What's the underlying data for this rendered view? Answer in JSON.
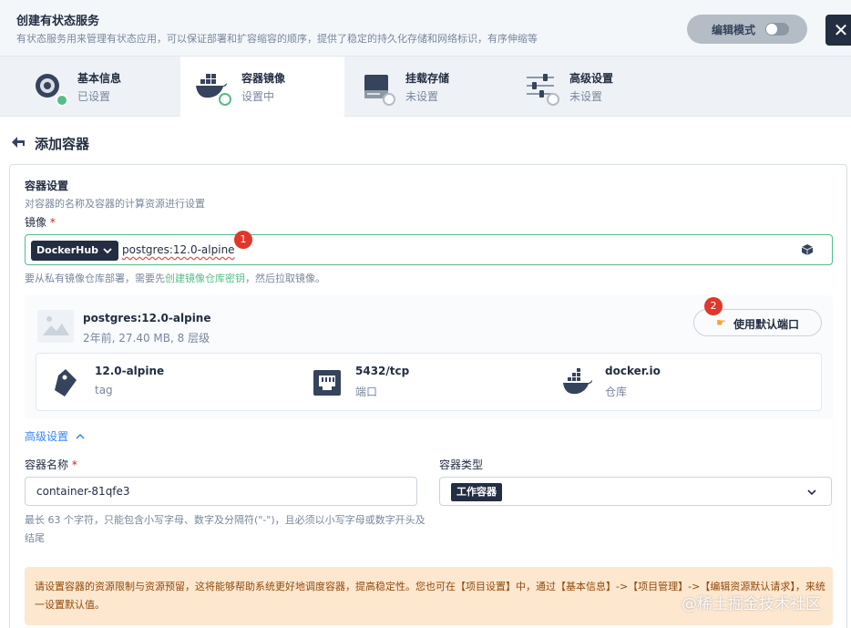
{
  "header": {
    "title": "创建有状态服务",
    "description": "有状态服务用来管理有状态应用，可以保证部署和扩容缩容的顺序，提供了稳定的持久化存储和网络标识，有序伸缩等",
    "edit_mode_label": "编辑模式",
    "close_symbol": "✕"
  },
  "steps": [
    {
      "title": "基本信息",
      "status": "已设置",
      "icon": "settings-disc-icon",
      "state": "done"
    },
    {
      "title": "容器镜像",
      "status": "设置中",
      "icon": "docker-whale-icon",
      "state": "current"
    },
    {
      "title": "挂载存储",
      "status": "未设置",
      "icon": "hard-drive-icon",
      "state": "pending"
    },
    {
      "title": "高级设置",
      "status": "未设置",
      "icon": "sliders-icon",
      "state": "pending"
    }
  ],
  "page": {
    "back_title": "添加容器"
  },
  "container_settings": {
    "title": "容器设置",
    "description": "对容器的名称及容器的计算资源进行设置",
    "image_label": "镜像",
    "required_mark": "*",
    "registry": "DockerHub",
    "image_value": "postgres:12.0-alpine",
    "hint_prefix": "要从私有镜像仓库部署，需要先",
    "hint_link": "创建镜像仓库密钥",
    "hint_suffix": "，然后拉取镜像。"
  },
  "annotations": {
    "badge_1": "1",
    "badge_2": "2"
  },
  "image_info": {
    "name": "postgres:12.0-alpine",
    "meta": "2年前, 27.40 MB, 8 层级",
    "use_default_ports_label": "使用默认端口",
    "tag_value": "12.0-alpine",
    "tag_label": "tag",
    "port_value": "5432/tcp",
    "port_label": "端口",
    "registry_value": "docker.io",
    "registry_label": "仓库"
  },
  "advanced": {
    "toggle_label": "高级设置"
  },
  "form": {
    "name_label": "容器名称",
    "name_value": "container-81qfe3",
    "type_label": "容器类型",
    "type_value": "工作容器",
    "name_help": "最长 63 个字符，只能包含小写字母、数字及分隔符(\"-\")，且必须以小写字母或数字开头及结尾"
  },
  "warning": {
    "text": "请设置容器的资源限制与资源预留，这将能够帮助系统更好地调度容器，提高稳定性。您也可在【项目设置】中，通过【基本信息】->【项目管理】->【编辑资源默认请求】，来统一设置默认值。"
  },
  "watermark": "@稀土掘金技术社区",
  "colors": {
    "accent_green": "#55bc8a",
    "dark": "#242e42",
    "link_blue": "#3385ff",
    "warning_bg": "#fde7cf",
    "badge_red": "#e0372c"
  }
}
